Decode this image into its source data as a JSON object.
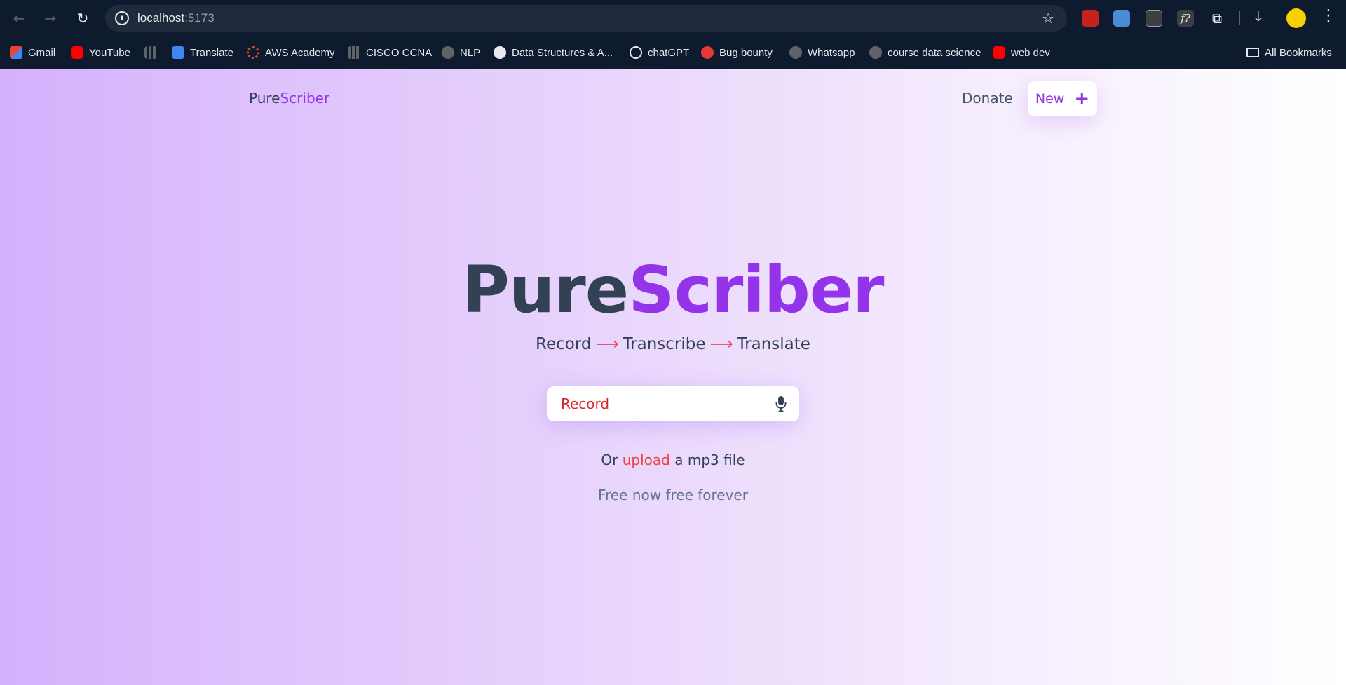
{
  "browser": {
    "url_host": "localhost",
    "url_port": ":5173",
    "extensions": [
      "video-extension-icon",
      "translate-extension-icon",
      "reader-extension-icon",
      "formula-extension-icon",
      "puzzle-extensions-icon"
    ]
  },
  "bookmarks": {
    "items": [
      {
        "label": "Gmail"
      },
      {
        "label": "YouTube"
      },
      {
        "label": "Translate"
      },
      {
        "label": "AWS Academy"
      },
      {
        "label": "CISCO CCNA"
      },
      {
        "label": "NLP"
      },
      {
        "label": "Data Structures & A..."
      },
      {
        "label": "chatGPT"
      },
      {
        "label": "Bug bounty"
      },
      {
        "label": "Whatsapp"
      },
      {
        "label": "course data science"
      },
      {
        "label": "web dev"
      }
    ],
    "all_bookmarks": "All Bookmarks"
  },
  "header": {
    "logo_part1": "Pure",
    "logo_part2": "Scriber",
    "donate": "Donate",
    "new_label": "New",
    "new_icon": "+"
  },
  "hero": {
    "title_part1": "Pure",
    "title_part2": "Scriber",
    "step1": "Record",
    "step2": "Transcribe",
    "step3": "Translate",
    "arrow": "⟶",
    "record_label": "Record",
    "upload_prefix": "Or",
    "upload_link": "upload",
    "upload_suffix": "a mp3 file",
    "free_text": "Free now free forever"
  },
  "colors": {
    "accent": "#9333ea",
    "record_text": "#dc2626",
    "arrow": "#f43f5e",
    "upload_link": "#ef4444"
  }
}
